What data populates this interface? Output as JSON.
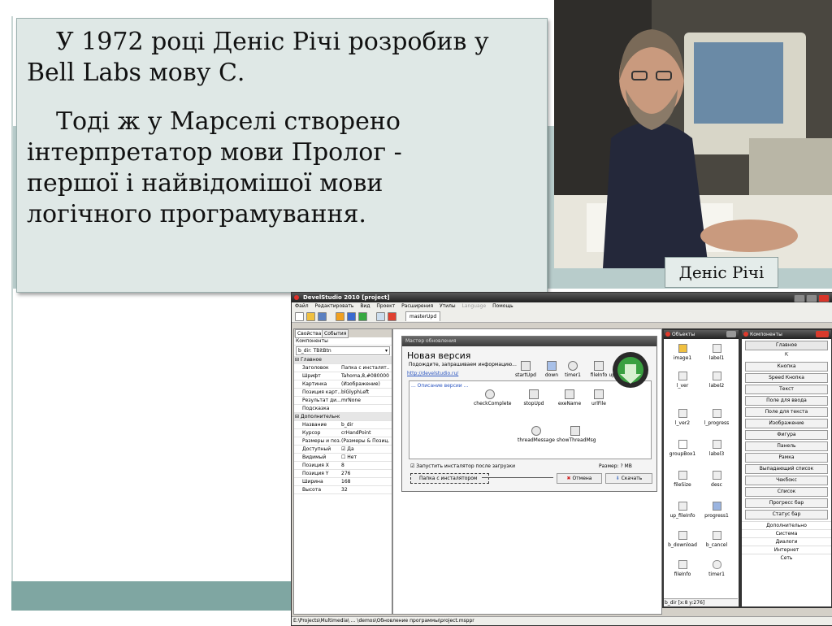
{
  "slide": {
    "paragraph_1": "У 1972 році Деніс Річі розробив у Bell Labs мову С.",
    "paragraph_2": "Тоді ж у Марселі створено інтерпретатор мови Пролог - першої і найвідомішої мови логічного програмування.",
    "caption": "Деніс Річі"
  },
  "app": {
    "title": "DevelStudio 2010 [project]",
    "menu": [
      "Файл",
      "Редактировать",
      "Вид",
      "Проект",
      "Расширения",
      "Утилы"
    ],
    "menu_disabled": "Language",
    "menu_help": "Помощь",
    "doc_tab": "masterUpd",
    "props": {
      "tab_props": "Свойства",
      "tab_events": "События",
      "components_label": "Компоненты",
      "selected": "b_dir: TBitBtn",
      "group_main": "Главное",
      "group_extra": "Дополнительно",
      "rows_main": [
        {
          "k": "Заголовок",
          "v": "Папка с инсталят..."
        },
        {
          "k": "Шрифт",
          "v": "Tahoma,8,#080000"
        },
        {
          "k": "Картинка",
          "v": "(Изображение)"
        },
        {
          "k": "Позиция карт...",
          "v": "blGlyphLeft"
        },
        {
          "k": "Результат ди...",
          "v": "mrNone"
        },
        {
          "k": "Подсказка",
          "v": ""
        }
      ],
      "rows_extra": [
        {
          "k": "Название",
          "v": "b_dir"
        },
        {
          "k": "Курсор",
          "v": "crHandPoint"
        },
        {
          "k": "Размеры и поз...",
          "v": "(Размеры & Позиц..."
        },
        {
          "k": "Доступный",
          "v": "Да"
        },
        {
          "k": "Видимый",
          "v": "Нет"
        },
        {
          "k": "Позиция X",
          "v": "8"
        },
        {
          "k": "Позиция Y",
          "v": "276"
        },
        {
          "k": "Ширина",
          "v": "168"
        },
        {
          "k": "Высота",
          "v": "32"
        }
      ]
    },
    "dialog": {
      "title": "Мастер обновления",
      "version": "Новая версия",
      "subtitle": "Подождите, запрашиваем информацию...",
      "link": "http://develstudio.ru/",
      "desc_label": "... Описание версии ...",
      "components": [
        "startUpd",
        "down",
        "timer1",
        "fileInfo",
        "up_fileInfo",
        "checkComplete",
        "stopUpd",
        "exeName",
        "urlFile",
        "threadMessage",
        "showThreadMsg"
      ],
      "checkbox": "Запустить инсталятор после загрузки",
      "size": "Размер: ? MB",
      "btn_folder": "Папка с инсталятором",
      "btn_cancel": "Отмена",
      "btn_download": "Скачать"
    },
    "objects": {
      "title": "Объекты",
      "items": [
        "image1",
        "label1",
        "l_ver",
        "label2",
        "l_ver2",
        "l_progress",
        "groupBox1",
        "label3",
        "fileSize",
        "desc",
        "up_fileInfo",
        "progress1",
        "b_download",
        "b_cancel",
        "fileInfo",
        "timer1"
      ],
      "footer": "b_dir [x:8 y:276]"
    },
    "components": {
      "title": "Компоненты",
      "main": "Главное",
      "buttons": [
        "Кнопка",
        "Speed Кнопка",
        "Текст",
        "Поле для ввода",
        "Поле для текста",
        "Изображение",
        "Фигура",
        "Панель",
        "Рамка",
        "Выпадающий список",
        "Чекбокс",
        "Список",
        "Прогресс бар",
        "Статус бар"
      ],
      "groups": [
        "Дополнительно",
        "Система",
        "Диалоги",
        "Интернет",
        "Сеть"
      ]
    },
    "status": "E:\\Projects\\Multimedia\\ ... \\demos\\Обновление программы\\project.msppr"
  }
}
